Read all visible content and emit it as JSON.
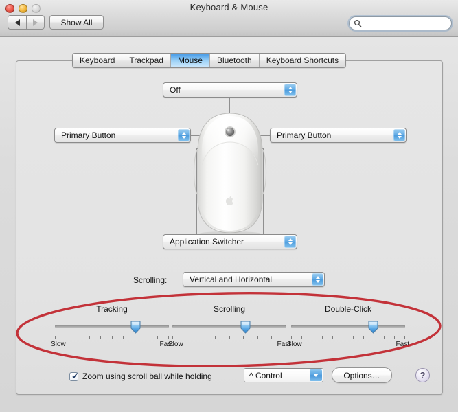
{
  "window": {
    "title": "Keyboard & Mouse",
    "traffic_lights": [
      "close",
      "minimize",
      "zoom"
    ]
  },
  "toolbar": {
    "back_icon": "triangle-left-icon",
    "forward_icon": "triangle-right-icon",
    "show_all_label": "Show All",
    "search": {
      "icon": "search-icon",
      "value": "",
      "placeholder": ""
    }
  },
  "tabs": [
    {
      "label": "Keyboard",
      "selected": false
    },
    {
      "label": "Trackpad",
      "selected": false
    },
    {
      "label": "Mouse",
      "selected": true
    },
    {
      "label": "Bluetooth",
      "selected": false
    },
    {
      "label": "Keyboard Shortcuts",
      "selected": false
    }
  ],
  "mouse_assignments": {
    "scroll_ball": "Off",
    "left_button": "Primary Button",
    "right_button": "Primary Button",
    "side_buttons": "Application Switcher"
  },
  "scrolling_row": {
    "label": "Scrolling:",
    "value": "Vertical and Horizontal"
  },
  "sliders": [
    {
      "title": "Tracking",
      "min_label": "Slow",
      "max_label": "Fast",
      "ticks": 11,
      "value_percent": 72
    },
    {
      "title": "Scrolling",
      "min_label": "Slow",
      "max_label": "Fast",
      "ticks": 9,
      "value_percent": 65
    },
    {
      "title": "Double-Click",
      "min_label": "Slow",
      "max_label": "Fast",
      "ticks": 12,
      "value_percent": 73
    }
  ],
  "bottom": {
    "zoom_checkbox_checked": true,
    "zoom_checkbox_label": "Zoom using scroll ball while holding",
    "modifier_value": "^ Control",
    "options_label": "Options…",
    "help_label": "?"
  },
  "colors": {
    "accent_blue": "#4d9fe8",
    "annotation_red": "#c0232a",
    "panel_bg": "#e4e4e4",
    "titlebar_bg": "#dadada"
  },
  "annotation": {
    "shape": "ellipse",
    "color": "#c0232a",
    "encircles": "tracking-scrolling-double-click-sliders"
  }
}
